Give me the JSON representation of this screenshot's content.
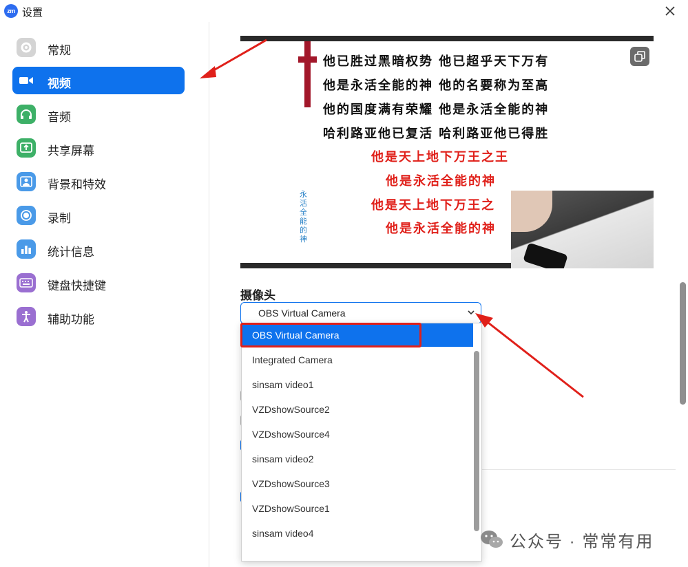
{
  "window": {
    "title": "设置",
    "logo_text": "zm"
  },
  "sidebar": {
    "items": [
      {
        "label": "常规",
        "icon": "gear-icon",
        "color": "#cfcfcf"
      },
      {
        "label": "视频",
        "icon": "video-camera-icon",
        "color": "#0e72ed",
        "active": true
      },
      {
        "label": "音频",
        "icon": "headphones-icon",
        "color": "#3db067"
      },
      {
        "label": "共享屏幕",
        "icon": "share-screen-icon",
        "color": "#3db067"
      },
      {
        "label": "背景和特效",
        "icon": "background-person-icon",
        "color": "#4a9ae8"
      },
      {
        "label": "录制",
        "icon": "record-icon",
        "color": "#4a9ae8"
      },
      {
        "label": "统计信息",
        "icon": "statistics-icon",
        "color": "#4a9ae8"
      },
      {
        "label": "键盘快捷键",
        "icon": "keyboard-icon",
        "color": "#9a6fd1"
      },
      {
        "label": "辅助功能",
        "icon": "accessibility-icon",
        "color": "#9a6fd1"
      }
    ]
  },
  "preview": {
    "lyrics_black": [
      "他已胜过黑暗权势 他已超乎天下万有",
      "他是永活全能的神 他的名要称为至高",
      "他的国度满有荣耀 他是永活全能的神",
      "哈利路亚他已复活 哈利路亚他已得胜"
    ],
    "lyrics_red": [
      "他是天上地下万王之王",
      "他是永活全能的神",
      "他是天上地下万王之",
      "他是永活全能的神"
    ],
    "vertical_text": "永活全能的神"
  },
  "camera": {
    "section_title": "摄像头",
    "selected_value": "OBS Virtual Camera",
    "options": [
      "OBS Virtual Camera",
      "Integrated Camera",
      "sinsam video1",
      "VZDshowSource2",
      "VZDshowSource4",
      "sinsam video2",
      "VZDshowSource3",
      "VZDshowSource1",
      "sinsam video4"
    ]
  },
  "watermark": {
    "text": "公众号 · 常常有用"
  },
  "colors": {
    "accent": "#0e72ed",
    "annotation_red": "#e0201a"
  }
}
